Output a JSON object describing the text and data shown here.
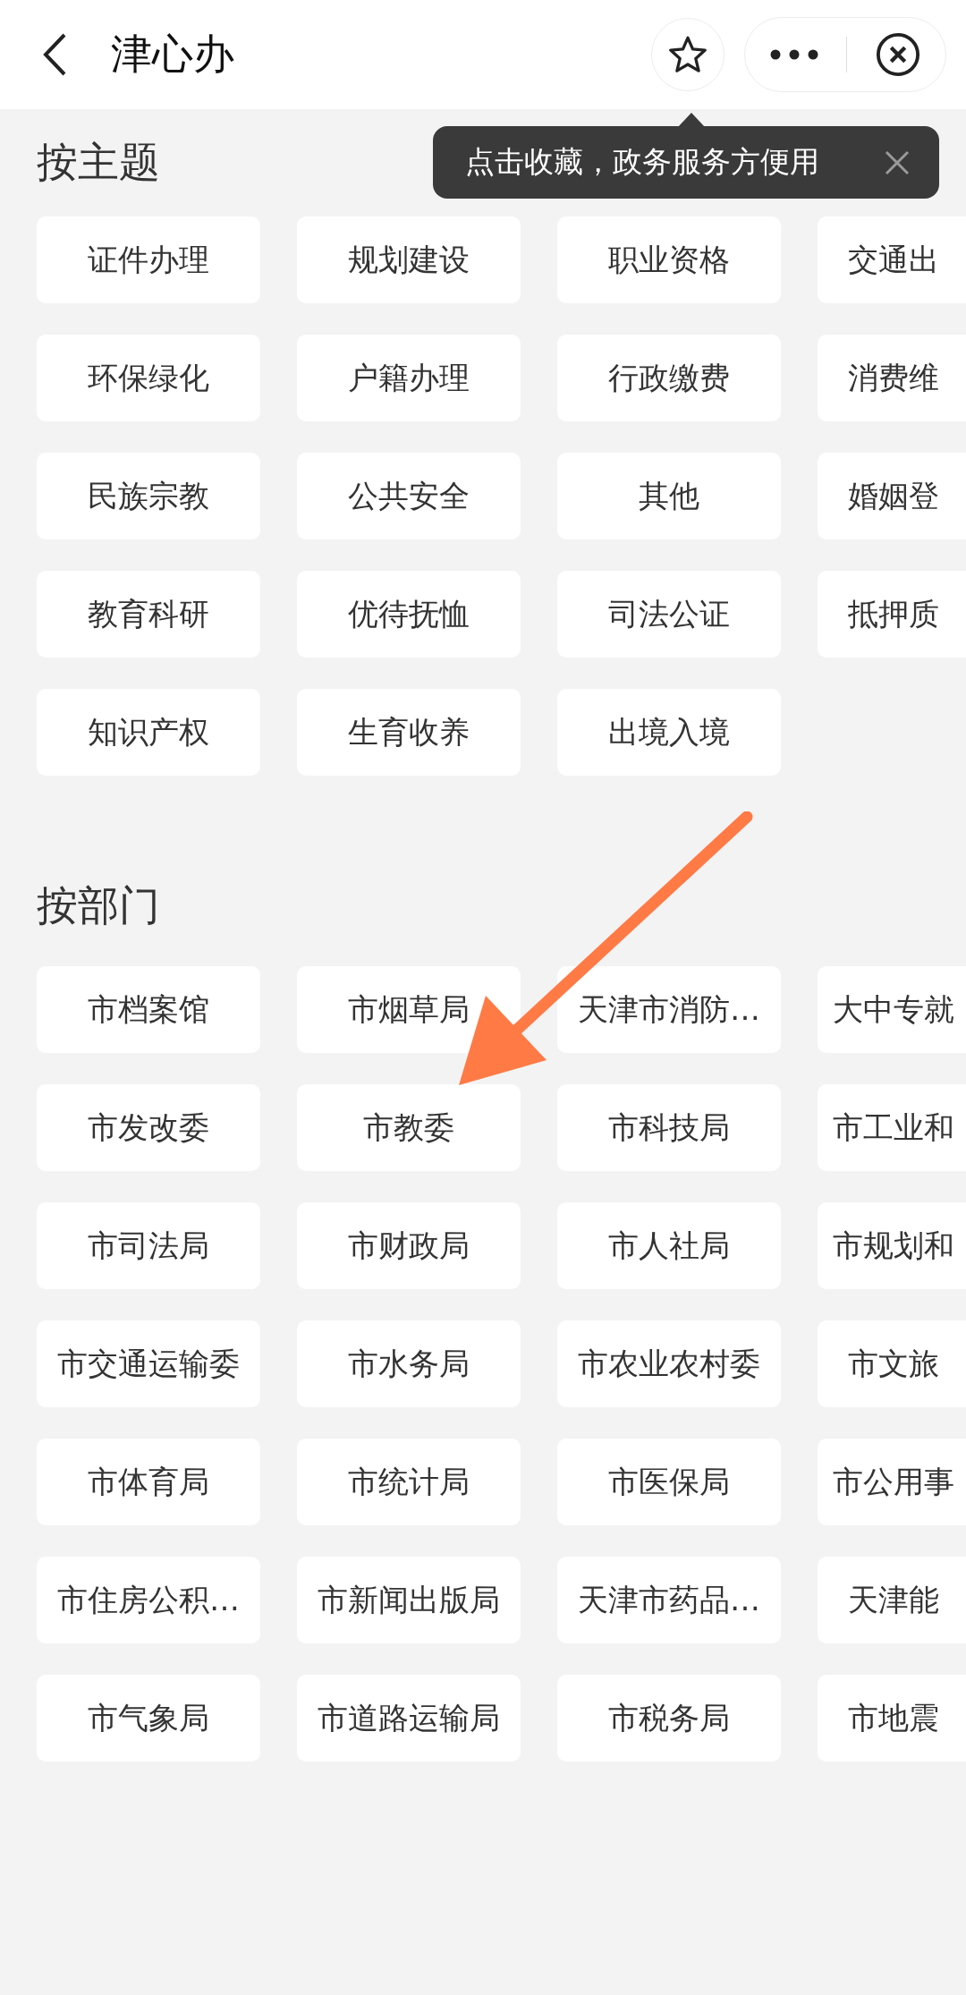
{
  "header": {
    "title": "津心办"
  },
  "tooltip": {
    "text": "点击收藏，政务服务方便用"
  },
  "sections": [
    {
      "title": "按主题",
      "items": [
        "证件办理",
        "规划建设",
        "职业资格",
        "交通出",
        "环保绿化",
        "户籍办理",
        "行政缴费",
        "消费维",
        "民族宗教",
        "公共安全",
        "其他",
        "婚姻登",
        "教育科研",
        "优待抚恤",
        "司法公证",
        "抵押质",
        "知识产权",
        "生育收养",
        "出境入境"
      ]
    },
    {
      "title": "按部门",
      "items": [
        "市档案馆",
        "市烟草局",
        "天津市消防…",
        "大中专就",
        "市发改委",
        "市教委",
        "市科技局",
        "市工业和",
        "市司法局",
        "市财政局",
        "市人社局",
        "市规划和",
        "市交通运输委",
        "市水务局",
        "市农业农村委",
        "市文旅",
        "市体育局",
        "市统计局",
        "市医保局",
        "市公用事",
        "市住房公积…",
        "市新闻出版局",
        "天津市药品…",
        "天津能",
        "市气象局",
        "市道路运输局",
        "市税务局",
        "市地震"
      ]
    }
  ]
}
